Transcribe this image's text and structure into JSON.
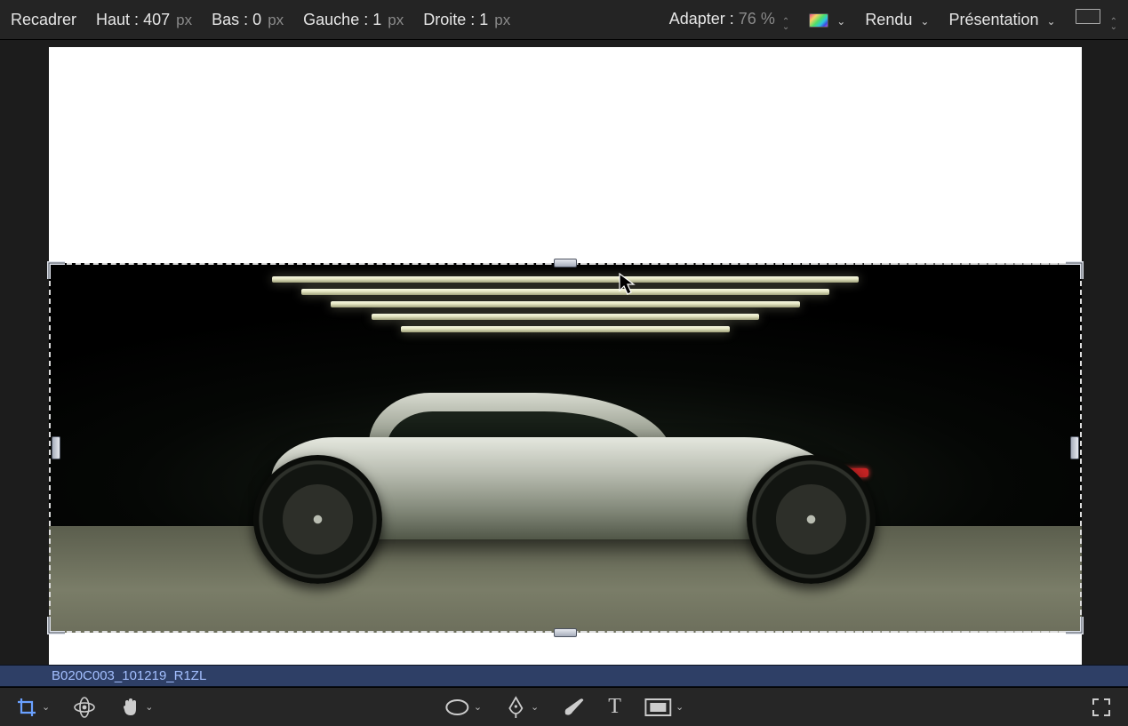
{
  "topbar": {
    "mode_label": "Recadrer",
    "haut": {
      "label": "Haut :",
      "value": "407",
      "unit": "px"
    },
    "bas": {
      "label": "Bas :",
      "value": "0",
      "unit": "px"
    },
    "gauche": {
      "label": "Gauche :",
      "value": "1",
      "unit": "px"
    },
    "droite": {
      "label": "Droite :",
      "value": "1",
      "unit": "px"
    },
    "adapter": {
      "label": "Adapter :",
      "value": "76",
      "unit": "%"
    },
    "rendu_label": "Rendu",
    "presentation_label": "Présentation"
  },
  "clip": {
    "name": "B020C003_101219_R1ZL"
  },
  "icons": {
    "crop": "crop-icon",
    "rotate": "rotate-3d-icon",
    "hand": "hand-icon",
    "mask": "mask-ellipse-icon",
    "pen": "pen-icon",
    "brush": "brush-icon",
    "text": "text-icon",
    "title": "title-safe-icon",
    "expand": "expand-icon",
    "colorwheel": "color-picker",
    "aspect": "aspect-ratio-box"
  }
}
